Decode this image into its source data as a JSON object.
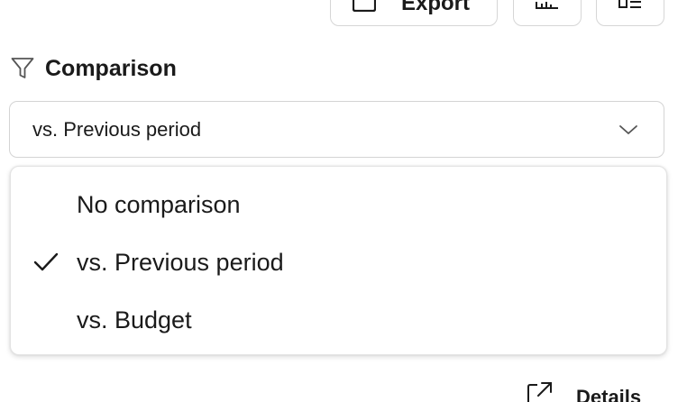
{
  "toolbar": {
    "export_label": "Export",
    "export_icon": "export-icon",
    "chart_icon": "bar-chart-icon",
    "list_icon": "list-view-icon"
  },
  "comparison": {
    "title": "Comparison",
    "icon": "filter-icon",
    "selected_value": "vs. Previous period",
    "options": [
      {
        "label": "No comparison",
        "selected": false
      },
      {
        "label": "vs. Previous period",
        "selected": true
      },
      {
        "label": "vs. Budget",
        "selected": false
      }
    ]
  },
  "footer": {
    "details_label": "Details",
    "details_icon": "open-external-icon"
  },
  "colors": {
    "border": "#d4d4d4",
    "text": "#1a1a1a",
    "icon": "#555555"
  }
}
